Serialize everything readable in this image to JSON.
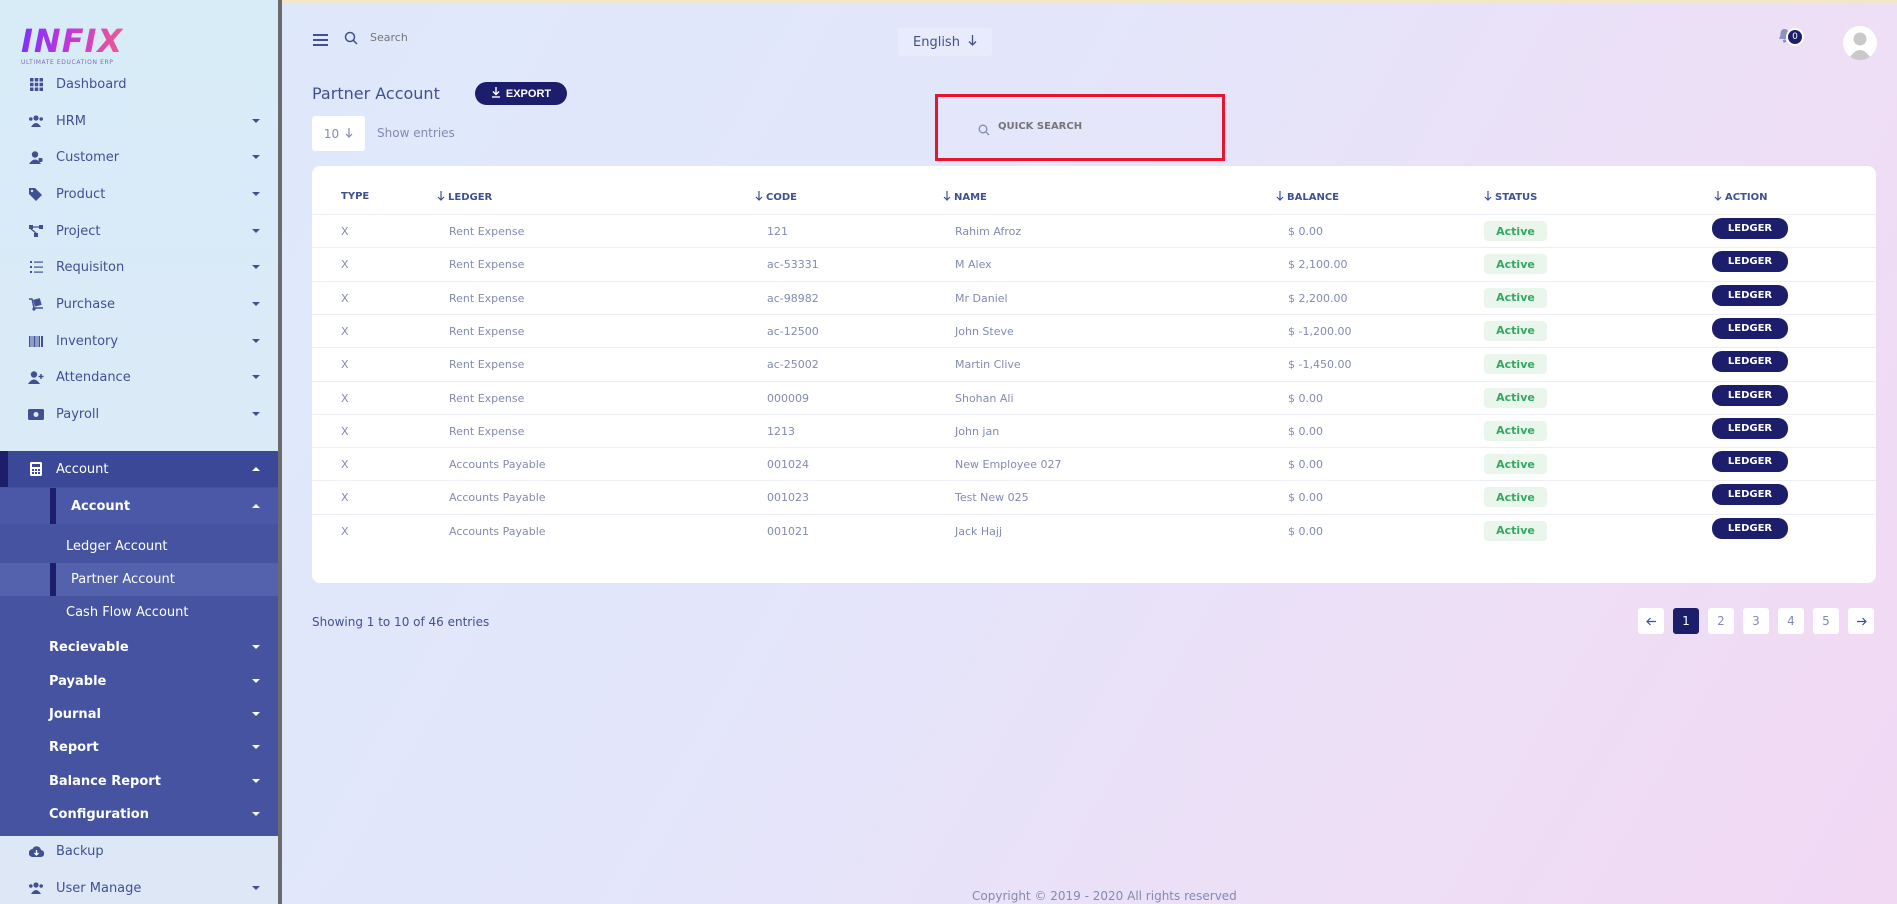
{
  "brand": {
    "logo": "INFIX",
    "tagline": "ULTIMATE EDUCATION ERP"
  },
  "header": {
    "search_placeholder": "Search",
    "language": "English",
    "notifications": "0"
  },
  "sidebar": {
    "items": [
      {
        "label": "Dashboard",
        "icon": "dashboard-icon"
      },
      {
        "label": "HRM",
        "icon": "users-icon"
      },
      {
        "label": "Customer",
        "icon": "user-icon"
      },
      {
        "label": "Product",
        "icon": "tags-icon"
      },
      {
        "label": "Project",
        "icon": "project-icon"
      },
      {
        "label": "Requisiton",
        "icon": "list-icon"
      },
      {
        "label": "Purchase",
        "icon": "dolly-icon"
      },
      {
        "label": "Inventory",
        "icon": "barcode-icon"
      },
      {
        "label": "Attendance",
        "icon": "user-plus-icon"
      },
      {
        "label": "Payroll",
        "icon": "money-icon"
      }
    ],
    "account": {
      "label": "Account",
      "sub_label": "Account",
      "children": [
        "Ledger Account",
        "Partner Account",
        "Cash Flow Account"
      ],
      "groups": [
        "Recievable",
        "Payable",
        "Journal",
        "Report",
        "Balance Report",
        "Configuration"
      ]
    },
    "bottom": [
      {
        "label": "Backup",
        "icon": "cloud-icon"
      },
      {
        "label": "User Manage",
        "icon": "users-icon"
      }
    ]
  },
  "page": {
    "title": "Partner Account",
    "export_label": "EXPORT",
    "entries": "10",
    "entries_label": "Show entries",
    "quick_search_placeholder": "QUICK SEARCH"
  },
  "table": {
    "headers": [
      "TYPE",
      "LEDGER",
      "CODE",
      "NAME",
      "BALANCE",
      "STATUS",
      "ACTION"
    ],
    "rows": [
      {
        "type": "X",
        "ledger": "Rent Expense",
        "code": "121",
        "name": "Rahim Afroz",
        "balance": "$ 0.00",
        "status": "Active",
        "action": "LEDGER"
      },
      {
        "type": "X",
        "ledger": "Rent Expense",
        "code": "ac-53331",
        "name": "M Alex",
        "balance": "$ 2,100.00",
        "status": "Active",
        "action": "LEDGER"
      },
      {
        "type": "X",
        "ledger": "Rent Expense",
        "code": "ac-98982",
        "name": "Mr Daniel",
        "balance": "$ 2,200.00",
        "status": "Active",
        "action": "LEDGER"
      },
      {
        "type": "X",
        "ledger": "Rent Expense",
        "code": "ac-12500",
        "name": "John Steve",
        "balance": "$ -1,200.00",
        "status": "Active",
        "action": "LEDGER"
      },
      {
        "type": "X",
        "ledger": "Rent Expense",
        "code": "ac-25002",
        "name": "Martin Clive",
        "balance": "$ -1,450.00",
        "status": "Active",
        "action": "LEDGER"
      },
      {
        "type": "X",
        "ledger": "Rent Expense",
        "code": "000009",
        "name": "Shohan Ali",
        "balance": "$ 0.00",
        "status": "Active",
        "action": "LEDGER"
      },
      {
        "type": "X",
        "ledger": "Rent Expense",
        "code": "1213",
        "name": "John jan",
        "balance": "$ 0.00",
        "status": "Active",
        "action": "LEDGER"
      },
      {
        "type": "X",
        "ledger": "Accounts Payable",
        "code": "001024",
        "name": "New Employee 027",
        "balance": "$ 0.00",
        "status": "Active",
        "action": "LEDGER"
      },
      {
        "type": "X",
        "ledger": "Accounts Payable",
        "code": "001023",
        "name": "Test New 025",
        "balance": "$ 0.00",
        "status": "Active",
        "action": "LEDGER"
      },
      {
        "type": "X",
        "ledger": "Accounts Payable",
        "code": "001021",
        "name": "Jack Hajj",
        "balance": "$ 0.00",
        "status": "Active",
        "action": "LEDGER"
      }
    ]
  },
  "pagination": {
    "summary": "Showing 1 to 10 of 46 entries",
    "pages": [
      "1",
      "2",
      "3",
      "4",
      "5"
    ],
    "current": "1"
  },
  "footer": "Copyright © 2019 - 2020 All rights reserved",
  "colors": {
    "primary": "#1d1e6b",
    "sidebar_active": "#4553a0",
    "text": "#415094",
    "muted": "#828bb2",
    "highlight": "#e8132e",
    "success": "#33a864"
  }
}
